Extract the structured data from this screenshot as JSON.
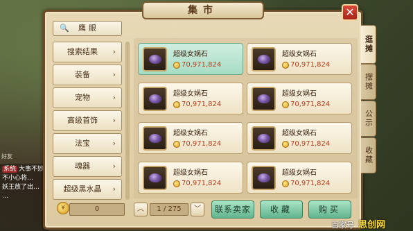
{
  "window": {
    "title": "集市",
    "close_label": "✕"
  },
  "chat": {
    "side_label": "好友",
    "lines": [
      {
        "tag": "",
        "text": "大事不妙"
      },
      {
        "tag": "",
        "text": "不小心将…"
      },
      {
        "tag": "",
        "text": "妖王放了出…"
      },
      {
        "tag": "",
        "text": "…"
      }
    ],
    "tag_label": "系统"
  },
  "search": {
    "icon": "search-icon",
    "label": "鹰眼"
  },
  "categories": [
    {
      "label": "搜索结果"
    },
    {
      "label": "装备"
    },
    {
      "label": "宠物"
    },
    {
      "label": "高级首饰"
    },
    {
      "label": "法宝"
    },
    {
      "label": "魂器"
    },
    {
      "label": "超级黑水晶"
    }
  ],
  "items": [
    {
      "name": "超级女娲石",
      "price": "70,971,824",
      "selected": true
    },
    {
      "name": "超级女娲石",
      "price": "70,971,824"
    },
    {
      "name": "超级女娲石",
      "price": "70,971,824"
    },
    {
      "name": "超级女娲石",
      "price": "70,971,824"
    },
    {
      "name": "超级女娲石",
      "price": "70,971,824"
    },
    {
      "name": "超级女娲石",
      "price": "70,971,824"
    },
    {
      "name": "超级女娲石",
      "price": "70,971,824"
    },
    {
      "name": "超级女娲石",
      "price": "70,971,824"
    }
  ],
  "side_tabs": [
    {
      "label": "逛摊",
      "active": true
    },
    {
      "label": "摆摊"
    },
    {
      "label": "公示"
    },
    {
      "label": "收藏"
    }
  ],
  "bottom": {
    "money": "0",
    "page": "1 / 275",
    "prev_label": "︿",
    "next_label": "﹀",
    "contact_label": "联系卖家",
    "favorite_label": "收藏",
    "buy_label": "购买"
  },
  "watermark": {
    "text": "百家号",
    "brand": "思创网"
  },
  "colors": {
    "price": "#b83a1a",
    "selected_card": "#a7dcc4",
    "action_button": "#62b48e"
  }
}
